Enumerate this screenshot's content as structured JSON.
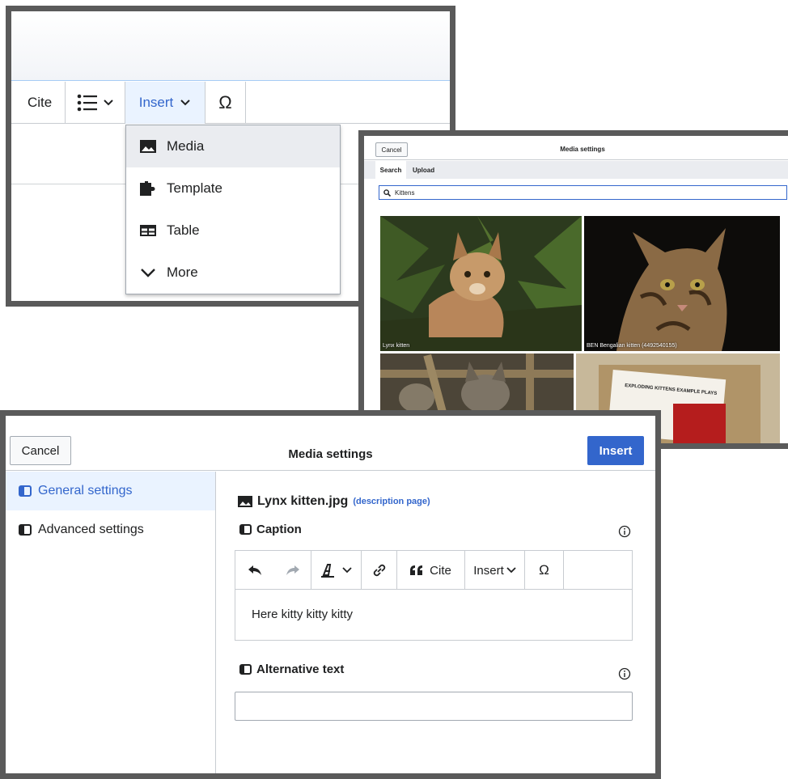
{
  "insert_panel": {
    "toolbar": {
      "cite_label": "Cite",
      "insert_label": "Insert",
      "special_char_label": "Ω"
    },
    "menu": [
      {
        "label": "Media",
        "icon": "image-icon"
      },
      {
        "label": "Template",
        "icon": "puzzle-icon"
      },
      {
        "label": "Table",
        "icon": "table-icon"
      },
      {
        "label": "More",
        "icon": "chevron-down-icon"
      }
    ],
    "accent_color": "#3366cc"
  },
  "media_search_panel": {
    "cancel_label": "Cancel",
    "title": "Media settings",
    "tabs": [
      "Search",
      "Upload"
    ],
    "search_value": "Kittens",
    "results": [
      {
        "caption": "Lynx kitten"
      },
      {
        "caption": "BEN Bengalian kitten (4492540155)"
      },
      {
        "caption": ""
      },
      {
        "caption": "EXPLODING KITTENS EXAMPLE PLAYS"
      }
    ]
  },
  "media_settings_panel": {
    "cancel_label": "Cancel",
    "title": "Media settings",
    "insert_label": "Insert",
    "sidebar": [
      {
        "label": "General settings",
        "active": true
      },
      {
        "label": "Advanced settings",
        "active": false
      }
    ],
    "file_name": "Lynx kitten.jpg",
    "description_link": "(description page)",
    "caption_label": "Caption",
    "caption_toolbar": {
      "cite_label": "Cite",
      "insert_label": "Insert",
      "special_char_label": "Ω"
    },
    "caption_text": "Here kitty kitty kitty",
    "alt_text_label": "Alternative text",
    "alt_text_value": "",
    "primary_color": "#3366cc"
  }
}
